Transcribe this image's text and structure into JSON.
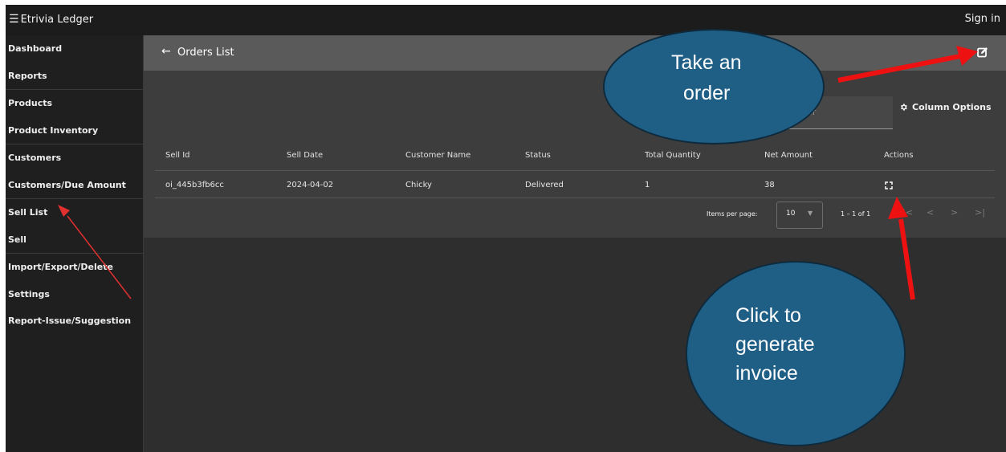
{
  "app": {
    "title": "Etrivia Ledger",
    "sign_in_label": "Sign in"
  },
  "sidebar": {
    "items": [
      {
        "label": "Dashboard"
      },
      {
        "label": "Reports"
      },
      {
        "label": "Products"
      },
      {
        "label": "Product Inventory"
      },
      {
        "label": "Customers"
      },
      {
        "label": "Customers/Due Amount"
      },
      {
        "label": "Sell List"
      },
      {
        "label": "Sell"
      },
      {
        "label": "Import/Export/Delete"
      },
      {
        "label": "Settings"
      },
      {
        "label": "Report-Issue/Suggestion"
      }
    ]
  },
  "page": {
    "title": "Orders List"
  },
  "filter": {
    "placeholder": "Filter"
  },
  "column_options_label": "Column Options",
  "table": {
    "headers": [
      "Sell Id",
      "Sell Date",
      "Customer Name",
      "Status",
      "Total Quantity",
      "Net Amount",
      "Actions"
    ],
    "rows": [
      {
        "sell_id": "oi_445b3fb6cc",
        "sell_date": "2024-04-02",
        "customer_name": "Chicky",
        "status": "Delivered",
        "total_quantity": "1",
        "net_amount": "38"
      }
    ]
  },
  "pagination": {
    "items_per_page_label": "Items per page:",
    "page_size": "10",
    "range": "1 – 1 of 1"
  },
  "annotations": {
    "take_order_line1": "Take an",
    "take_order_line2": "order",
    "invoice_line1": "Click to",
    "invoice_line2": "generate",
    "invoice_line3": "invoice"
  },
  "colors": {
    "topbar": "#1c1c1c",
    "sidebar": "#1f1f1f",
    "header_bar": "#5a5a5a",
    "panel": "#3d3d3d",
    "bubble_fill": "#1f5f86",
    "arrow_red": "#ee1111"
  }
}
